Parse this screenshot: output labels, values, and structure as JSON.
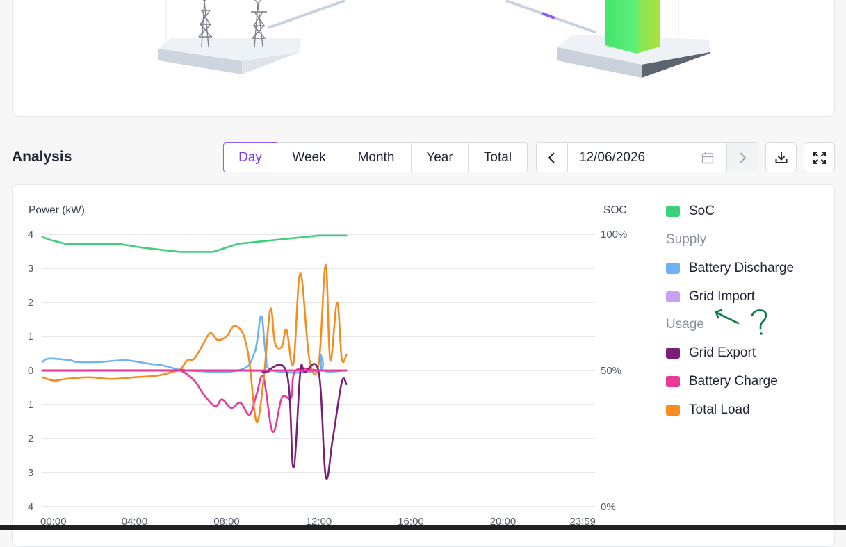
{
  "analysis": {
    "title": "Analysis",
    "tabs": [
      "Day",
      "Week",
      "Month",
      "Year",
      "Total"
    ],
    "active_tab": "Day",
    "date_value": "12/06/2026"
  },
  "icons": {
    "prev": "chevron-left-icon",
    "next": "chevron-right-icon",
    "calendar": "calendar-icon",
    "download": "download-icon",
    "fullscreen": "fullscreen-icon"
  },
  "legend": {
    "soc": "SoC",
    "supply_label": "Supply",
    "battery_discharge": "Battery Discharge",
    "grid_import": "Grid Import",
    "usage_label": "Usage",
    "grid_export": "Grid Export",
    "battery_charge": "Battery Charge",
    "total_load": "Total Load"
  },
  "colors": {
    "accent": "#7c3aed",
    "soc": "#3ecf7a",
    "battery_discharge": "#6cb2f5",
    "grid_import": "#c8a0f6",
    "grid_export": "#7a1f76",
    "battery_charge": "#e8399b",
    "total_load": "#f78c1e",
    "annotation": "#0f7a3f"
  },
  "chart_data": {
    "type": "line",
    "ylabel_left": "Power (kW)",
    "ylabel_right": "SOC",
    "x_ticks": [
      "00:00",
      "04:00",
      "08:00",
      "12:00",
      "16:00",
      "20:00",
      "23:59"
    ],
    "y_ticks_left": [
      "4",
      "3",
      "2",
      "1",
      "0",
      "1",
      "2",
      "3",
      "4"
    ],
    "y_ticks_right": [
      "100%",
      "50%",
      "0%"
    ],
    "ylim_left": [
      -4,
      4
    ],
    "ylim_right": [
      0,
      100
    ],
    "grid": true,
    "legend_position": "right",
    "series": [
      {
        "name": "SoC",
        "axis": "right",
        "color_key": "soc",
        "x": [
          0,
          0.3,
          1,
          1.5,
          3.3,
          4.4,
          6,
          7.4,
          8.5,
          12,
          13.2
        ],
        "y": [
          99,
          98,
          96.5,
          96.5,
          96.5,
          95,
          93.5,
          93.5,
          96.5,
          99.5,
          99.5
        ]
      },
      {
        "name": "Battery Discharge",
        "axis": "left",
        "color_key": "battery_discharge",
        "x": [
          0,
          0.3,
          1.2,
          1.5,
          2.5,
          3.6,
          4.6,
          5.2,
          5.8,
          6.2,
          8.5,
          9.2,
          9.5,
          9.7,
          10,
          12,
          12.1,
          12.2,
          13.2
        ],
        "y": [
          0.25,
          0.35,
          0.3,
          0.25,
          0.25,
          0.3,
          0.2,
          0.15,
          0.05,
          0,
          0,
          0.5,
          1.6,
          0.5,
          0,
          0,
          0.45,
          0,
          0
        ]
      },
      {
        "name": "Grid Import",
        "axis": "left",
        "color_key": "grid_import",
        "x": [
          0,
          13.2
        ],
        "y": [
          0,
          0
        ]
      },
      {
        "name": "Grid Export",
        "axis": "left",
        "color_key": "grid_export",
        "x": [
          0,
          9,
          9.6,
          10.6,
          10.9,
          11.2,
          11.4,
          12,
          12.3,
          12.6,
          13,
          13.2
        ],
        "y": [
          0,
          0,
          -0.05,
          -0.05,
          -2.85,
          -0.05,
          -0.05,
          -0.05,
          -3.1,
          -2.05,
          -0.35,
          -0.4
        ]
      },
      {
        "name": "Battery Charge",
        "axis": "left",
        "color_key": "battery_charge",
        "x": [
          0,
          5.6,
          6,
          6.6,
          7,
          7.5,
          7.8,
          8.2,
          8.6,
          9,
          9.3,
          9.6,
          10,
          10.4,
          10.8,
          11,
          12,
          12.5,
          13.2
        ],
        "y": [
          0,
          0,
          0,
          -0.3,
          -0.7,
          -1.05,
          -0.85,
          -1.1,
          -0.95,
          -1.3,
          -0.7,
          -0.2,
          -1.8,
          -0.8,
          -0.8,
          0,
          0,
          0,
          0
        ]
      },
      {
        "name": "Total Load",
        "axis": "left",
        "color_key": "total_load",
        "x": [
          0,
          0.5,
          1,
          2,
          3,
          4,
          5,
          5.6,
          6,
          6.3,
          6.6,
          7,
          7.3,
          7.6,
          8,
          8.3,
          8.6,
          8.8,
          9,
          9.3,
          9.6,
          9.9,
          10.1,
          10.4,
          10.6,
          10.9,
          11.2,
          11.6,
          12,
          12.3,
          12.5,
          12.8,
          13,
          13.2
        ],
        "y": [
          -0.2,
          -0.3,
          -0.25,
          -0.2,
          -0.25,
          -0.2,
          -0.15,
          -0.05,
          0.05,
          0.3,
          0.35,
          0.8,
          1.1,
          0.9,
          1.0,
          1.3,
          1.2,
          0.9,
          0.2,
          -1.5,
          -0.3,
          1.8,
          0.8,
          0.7,
          1.2,
          0.2,
          2.85,
          0.3,
          0.2,
          3.1,
          0.3,
          2.0,
          0.35,
          0.45
        ]
      }
    ]
  }
}
